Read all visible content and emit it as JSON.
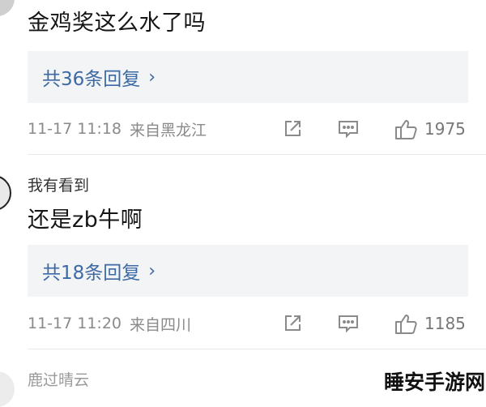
{
  "comments": [
    {
      "username": "",
      "content": "金鸡奖这么水了吗",
      "reply_label": "共36条回复",
      "chevron": "›",
      "timestamp": "11-17 11:18",
      "location": "来自黑龙江",
      "likes": "1975"
    },
    {
      "username": "我有看到",
      "content": "还是zb牛啊",
      "reply_label": "共18条回复",
      "chevron": "›",
      "timestamp": "11-17 11:20",
      "location": "来自四川",
      "likes": "1185"
    },
    {
      "username": "鹿过晴云"
    }
  ],
  "icons": {
    "share": "share-icon",
    "comment": "comment-icon",
    "like": "thumbs-up-icon"
  },
  "colors": {
    "link": "#3d6aa5",
    "meta": "#8a8a8a",
    "reply_bg": "#f3f4f6"
  },
  "watermark": "睡安手游网"
}
